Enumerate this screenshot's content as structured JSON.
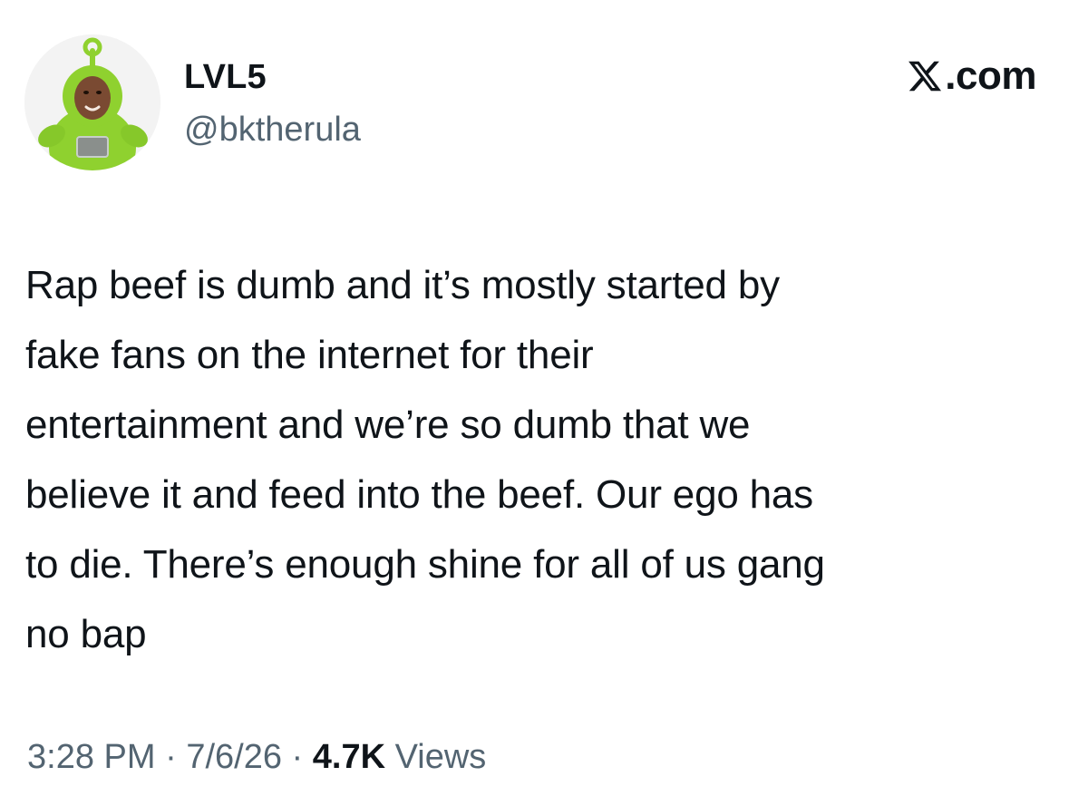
{
  "author": {
    "display_name": "LVL5",
    "handle": "@bktherula",
    "avatar_icon": "teletubby-avatar"
  },
  "brand": {
    "icon": "x-logo-icon",
    "label": ".com"
  },
  "tweet": {
    "text": "Rap beef is dumb and it’s mostly started by\nfake fans on the internet for their\nentertainment and we’re so dumb that we\nbelieve it and feed into the beef. Our ego has\nto die. There’s enough shine for all of us gang\nno bap"
  },
  "meta": {
    "time": "3:28 PM",
    "sep1": " · ",
    "date": "7/6/26",
    "sep2": " · ",
    "view_count": "4.7K",
    "views_label": " Views"
  },
  "colors": {
    "text_primary": "#0f1419",
    "text_secondary": "#536471",
    "avatar_green": "#8fd12f"
  }
}
